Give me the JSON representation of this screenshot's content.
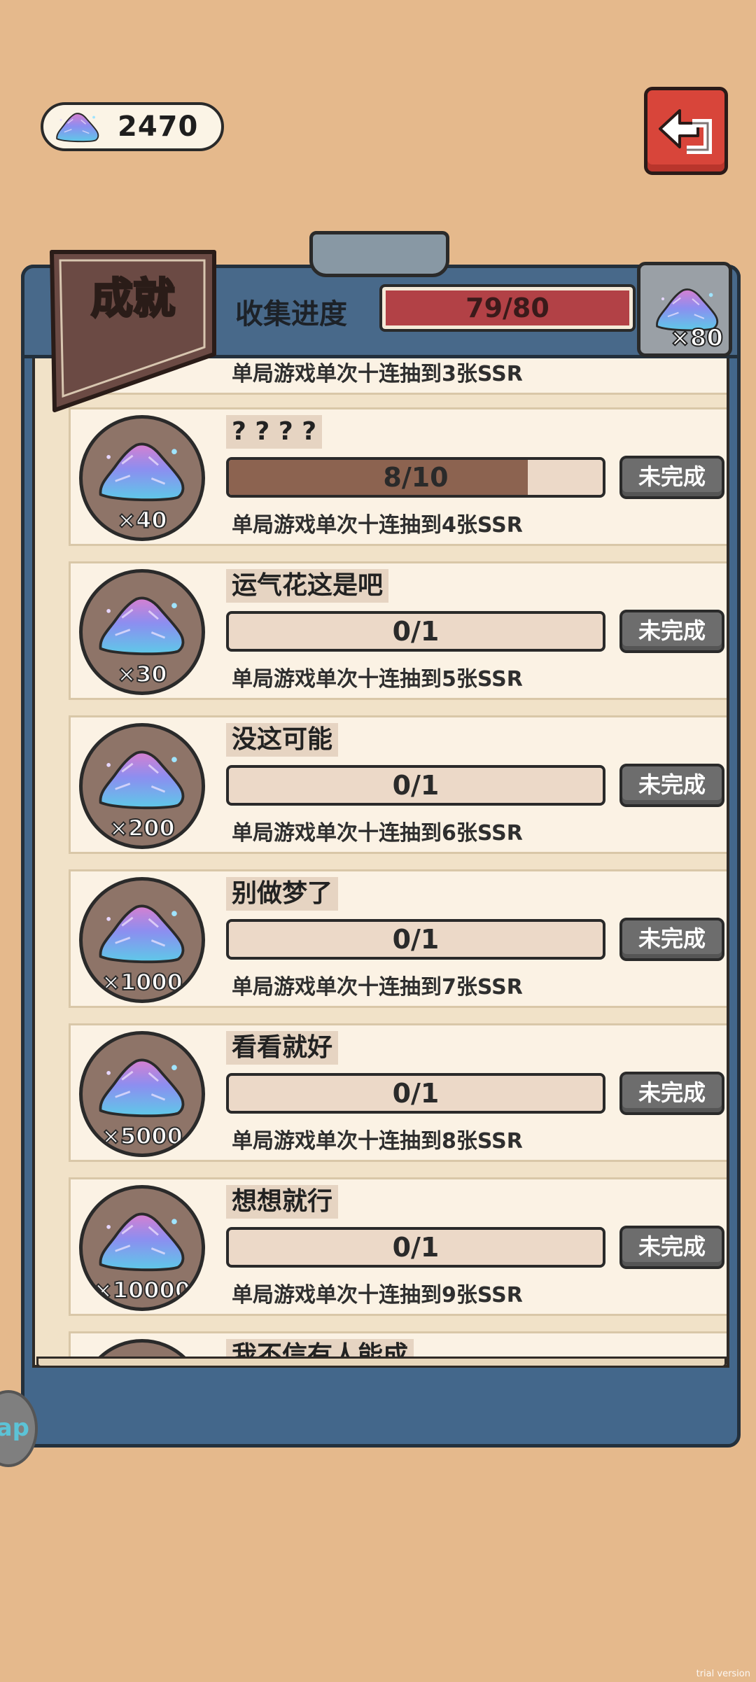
{
  "currency": {
    "icon": "crystal-gem-icon",
    "amount": "2470"
  },
  "header": {
    "title": "成就",
    "progress_label": "收集进度",
    "progress_text": "79/80",
    "reward_count": "×80"
  },
  "top_partial_desc": "单局游戏单次十连抽到3张SSR",
  "achievements": [
    {
      "name": "? ? ? ?",
      "reward": "×40",
      "progress": "8/10",
      "progress_fraction": 0.8,
      "status": "未完成",
      "desc": "单局游戏单次十连抽到4张SSR"
    },
    {
      "name": "运气花这是吧",
      "reward": "×30",
      "progress": "0/1",
      "progress_fraction": 0,
      "status": "未完成",
      "desc": "单局游戏单次十连抽到5张SSR"
    },
    {
      "name": "没这可能",
      "reward": "×200",
      "progress": "0/1",
      "progress_fraction": 0,
      "status": "未完成",
      "desc": "单局游戏单次十连抽到6张SSR"
    },
    {
      "name": "别做梦了",
      "reward": "×1000",
      "progress": "0/1",
      "progress_fraction": 0,
      "status": "未完成",
      "desc": "单局游戏单次十连抽到7张SSR"
    },
    {
      "name": "看看就好",
      "reward": "×5000",
      "progress": "0/1",
      "progress_fraction": 0,
      "status": "未完成",
      "desc": "单局游戏单次十连抽到8张SSR"
    },
    {
      "name": "想想就行",
      "reward": "×10000",
      "progress": "0/1",
      "progress_fraction": 0,
      "status": "未完成",
      "desc": "单局游戏单次十连抽到9张SSR"
    }
  ],
  "bottom_partial_name": "我不信有人能成",
  "side_tab": "ap",
  "watermark": "trial version"
}
